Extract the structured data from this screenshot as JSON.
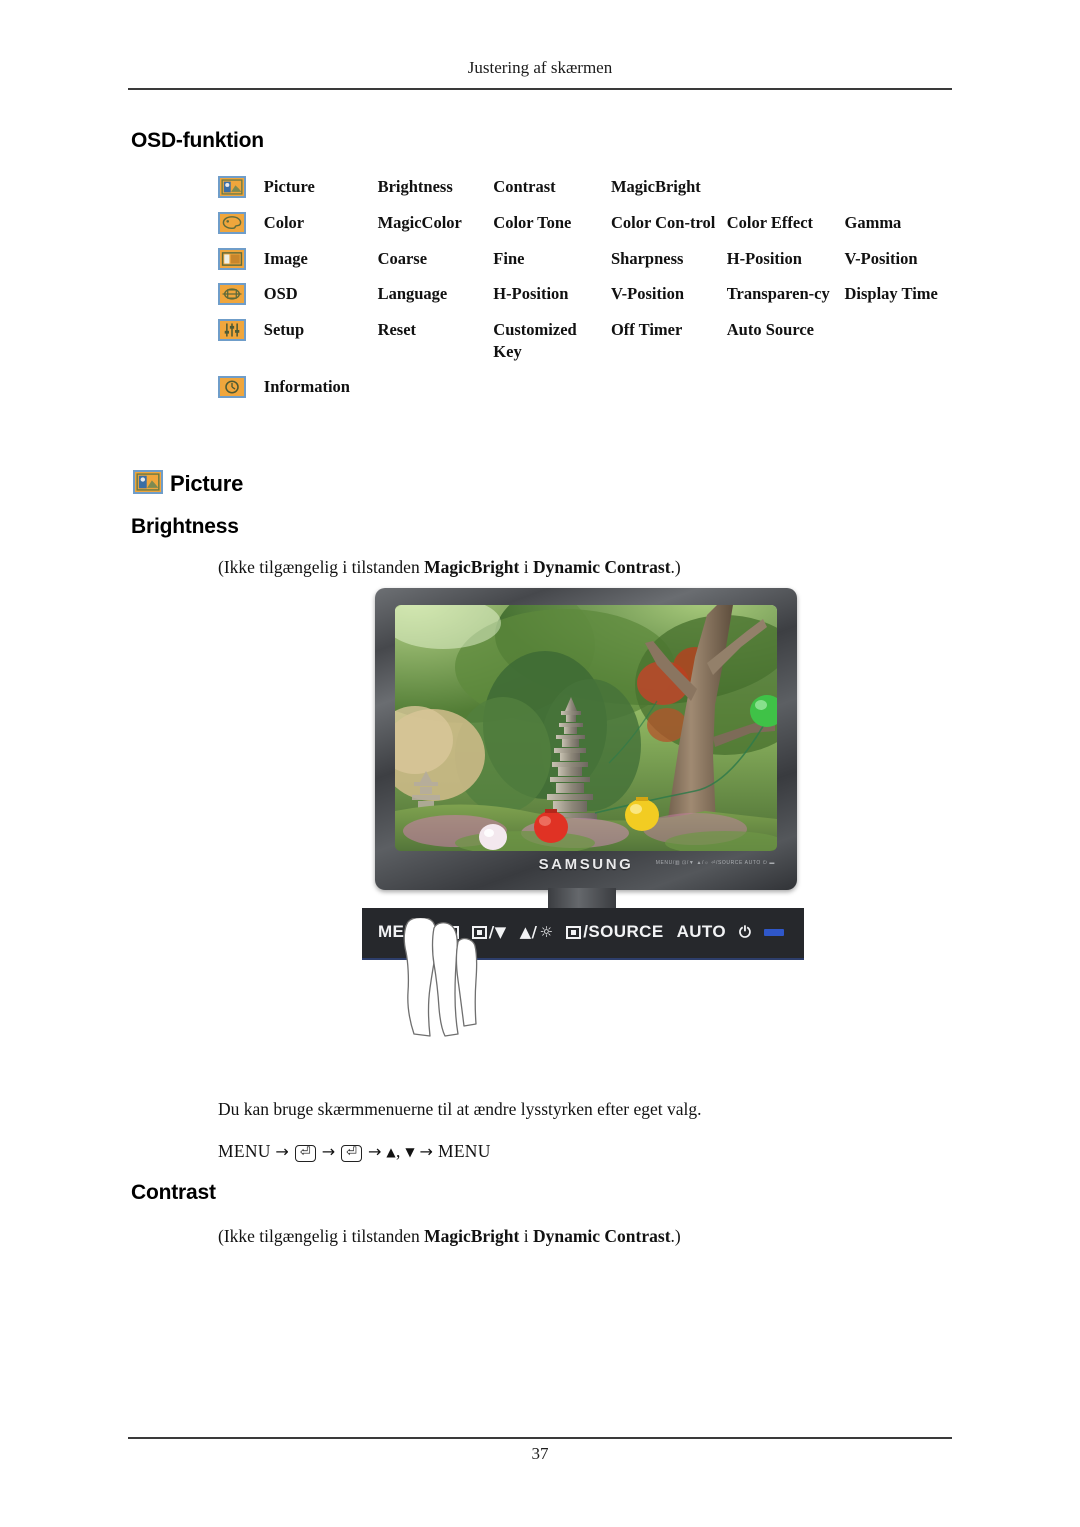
{
  "header": {
    "running_title": "Justering af skærmen"
  },
  "footer": {
    "page_number": "37"
  },
  "sections": {
    "osd_function_title": "OSD-funktion",
    "picture_title": "Picture",
    "brightness_title": "Brightness",
    "contrast_title": "Contrast"
  },
  "osd_table": {
    "rows": [
      {
        "icon": "picture-menu-icon",
        "name": "Picture",
        "items": [
          "Brightness",
          "Contrast",
          "MagicBright",
          "",
          ""
        ]
      },
      {
        "icon": "color-palette-menu-icon",
        "name": "Color",
        "items": [
          "MagicColor",
          "Color Tone",
          "Color Con-trol",
          "Color Effect",
          "Gamma"
        ]
      },
      {
        "icon": "image-menu-icon",
        "name": "Image",
        "items": [
          "Coarse",
          "Fine",
          "Sharpness",
          "H-Position",
          "V-Position"
        ]
      },
      {
        "icon": "osd-menu-icon",
        "name": "OSD",
        "items": [
          "Language",
          "H-Position",
          "V-Position",
          "Transparen-cy",
          "Display Time"
        ]
      },
      {
        "icon": "setup-sliders-menu-icon",
        "name": "Setup",
        "items": [
          "Reset",
          "Customized Key",
          "Off Timer",
          "Auto Source",
          ""
        ]
      },
      {
        "icon": "information-clock-menu-icon",
        "name": "Information",
        "items": [
          "",
          "",
          "",
          "",
          ""
        ]
      }
    ]
  },
  "brightness": {
    "note_prefix": "(Ikke tilgængelig i tilstanden ",
    "note_bold_1": "MagicBright",
    "note_mid": " i ",
    "note_bold_2": "Dynamic Contrast",
    "note_suffix": ".)",
    "description": "Du kan bruge skærmmenuerne til at ændre lysstyrken efter eget valg.",
    "path_start": "MENU",
    "path_end": "MENU",
    "path_arrow": "→",
    "path_enter_key": "⏎",
    "path_up": "▲",
    "path_down": "▼",
    "path_comma": ","
  },
  "contrast": {
    "note_prefix": "(Ikke tilgængelig i tilstanden ",
    "note_bold_1": "MagicBright",
    "note_mid": " i ",
    "note_bold_2": "Dynamic Contrast",
    "note_suffix": ".)"
  },
  "monitor": {
    "brand": "SAMSUNG",
    "bezel_mini_labels": "MENU/▥  ⊡/▼  ▲/☼  ⏎/SOURCE  AUTO  ⏻  ▬",
    "screen_alt": "garden scene with stone pagoda, trees and paper lanterns",
    "control_bar": {
      "menu_label": "MENU/",
      "down_label": "/▼",
      "up_label": "▲/",
      "brightness_symbol": "☼",
      "source_label": "/SOURCE",
      "auto_label": "AUTO",
      "power_symbol": "⏻"
    }
  },
  "colors": {
    "icon_background": "#f0a63c",
    "icon_border": "#6f9dc9",
    "icon_detail": "#5a6a3c",
    "control_bar_background": "#26282c",
    "control_bar_text": "#f2f3f5",
    "led_blue": "#2f57c9",
    "rule": "#3a3a3a"
  }
}
